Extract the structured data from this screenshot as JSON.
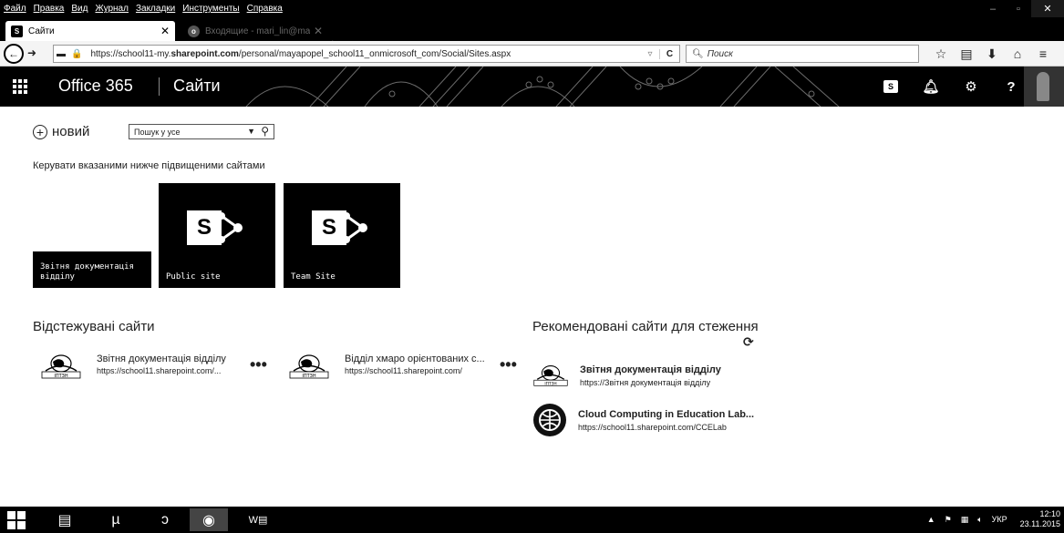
{
  "browser": {
    "menu": [
      "Файл",
      "Правка",
      "Вид",
      "Журнал",
      "Закладки",
      "Инструменты",
      "Справка"
    ],
    "tabs": [
      {
        "title": "Сайти",
        "favicon": "S",
        "active": true
      },
      {
        "title": "Входящие - mari_lin@mai...",
        "favicon": "o",
        "active": false
      }
    ],
    "url_prefix": "https://school11-my.",
    "url_domain": "sharepoint.com",
    "url_path": "/personal/mayapopel_school11_onmicrosoft_com/Social/Sites.aspx",
    "search_placeholder": "Поиск",
    "icons": [
      "back-icon",
      "forward-icon",
      "bookmarks-icon",
      "lock-icon",
      "reload-icon",
      "star-icon",
      "clipboard-icon",
      "download-icon",
      "home-icon",
      "menu-icon"
    ]
  },
  "suitebar": {
    "app_name": "Office 365",
    "page_name": "Сайти",
    "icons": [
      "app-launcher-icon",
      "sharepoint-icon",
      "bell-icon",
      "gear-icon",
      "help-icon"
    ]
  },
  "toolbar": {
    "new_label": "новий",
    "search_placeholder": "Пошук у усе"
  },
  "promoted": {
    "heading": "Керувати вказаними нижче підвищеними сайтами",
    "tiles": [
      {
        "label_line1": "Звітня документація",
        "label_line2": "відділу"
      },
      {
        "label": "Public site"
      },
      {
        "label": "Team Site"
      }
    ]
  },
  "followed": {
    "heading": "Відстежувані сайти",
    "items": [
      {
        "title": "Звітня документація відділу",
        "url": "https://school11.sharepoint.com/...",
        "logo_text": "ІПТЗН"
      },
      {
        "title": "Відділ хмаро орієнтованих с...",
        "url": "https://school11.sharepoint.com/",
        "logo_text": "ІПТЗН"
      }
    ]
  },
  "recommended": {
    "heading": "Рекомендовані сайти для стеження",
    "items": [
      {
        "title": "Звітня документація відділу",
        "url": "https://Звітня документація відділу",
        "logo_text": "ІПТЗН"
      },
      {
        "title": "Cloud Computing in Education Lab...",
        "url": "https://school11.sharepoint.com/CCELab"
      }
    ]
  },
  "taskbar": {
    "word_label": "W",
    "tray_lang": "УКР",
    "time": "12:10",
    "date": "23.11.2015"
  }
}
